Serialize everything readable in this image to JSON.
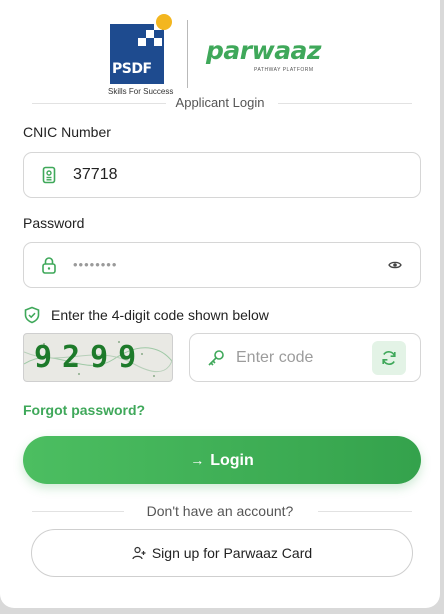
{
  "logos": {
    "psdf_text": "PSDF",
    "psdf_tagline": "Skills For Success",
    "parwaaz_text": "parwaaz",
    "parwaaz_subtitle": "PATHWAY PLATFORM"
  },
  "section_title": "Applicant Login",
  "cnic": {
    "label": "CNIC Number",
    "value": "37718",
    "icon": "id-card-icon"
  },
  "password": {
    "label": "Password",
    "masked_value": "••••••••",
    "icon": "lock-icon",
    "toggle_icon": "eye-icon"
  },
  "captcha": {
    "prompt": "Enter the 4-digit code shown below",
    "prompt_icon": "shield-icon",
    "code": "9299",
    "input_placeholder": "Enter code",
    "input_icon": "key-icon",
    "refresh_icon": "refresh-icon"
  },
  "forgot_password": "Forgot password?",
  "login_button": {
    "label": "Login",
    "icon": "arrow-right-icon"
  },
  "no_account_text": "Don't have an account?",
  "signup_button": {
    "label": "Sign up for Parwaaz Card",
    "icon": "user-plus-icon"
  },
  "colors": {
    "accent_green": "#3fa85a",
    "psdf_blue": "#1e4b8f",
    "psdf_yellow": "#f3b61f"
  }
}
